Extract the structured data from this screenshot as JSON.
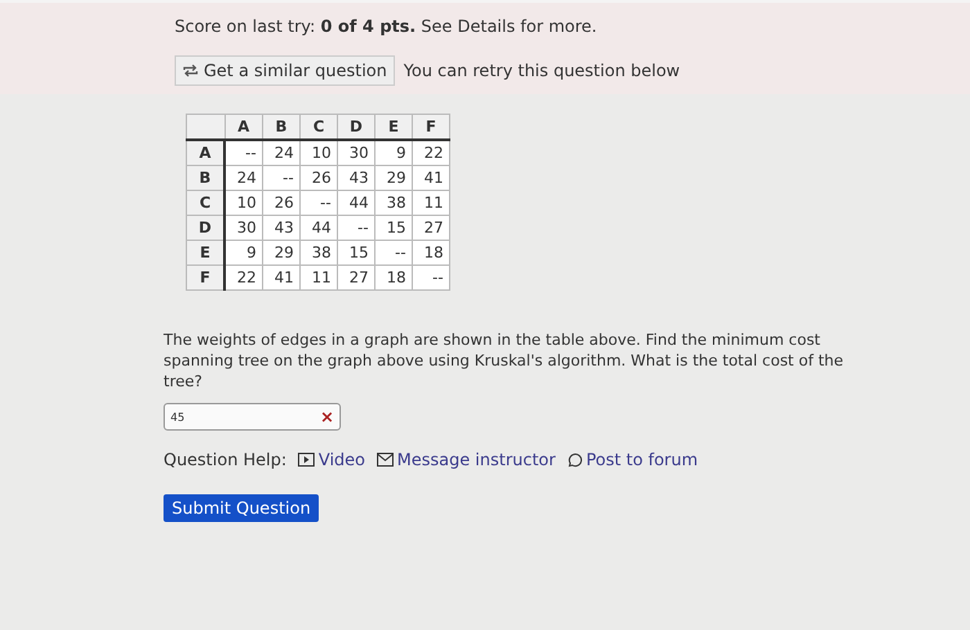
{
  "score_line": "Score on last try: **0 of 4 pts.** See Details for more.",
  "similar_button": {
    "label": "Get a similar question"
  },
  "retry_note": "You can retry this question below",
  "table": {
    "columns": [
      "A",
      "B",
      "C",
      "D",
      "E",
      "F"
    ],
    "rows": [
      {
        "label": "A",
        "cells": [
          "--",
          "24",
          "10",
          "30",
          "9",
          "22"
        ]
      },
      {
        "label": "B",
        "cells": [
          "24",
          "--",
          "26",
          "43",
          "29",
          "41"
        ]
      },
      {
        "label": "C",
        "cells": [
          "10",
          "26",
          "--",
          "44",
          "38",
          "11"
        ]
      },
      {
        "label": "D",
        "cells": [
          "30",
          "43",
          "44",
          "--",
          "15",
          "27"
        ]
      },
      {
        "label": "E",
        "cells": [
          "9",
          "29",
          "38",
          "15",
          "--",
          "18"
        ]
      },
      {
        "label": "F",
        "cells": [
          "22",
          "41",
          "11",
          "27",
          "18",
          "--"
        ]
      }
    ]
  },
  "question": "The weights of edges in a graph are shown in the table above. Find the minimum cost spanning tree on the graph above using Kruskal's algorithm. What is the total cost of the tree?",
  "answer": {
    "value": "45",
    "mark": "×"
  },
  "help": {
    "label": "Question Help:",
    "links": [
      {
        "kind": "video",
        "label": "Video"
      },
      {
        "kind": "message",
        "label": "Message instructor"
      },
      {
        "kind": "forum",
        "label": "Post to forum"
      }
    ]
  },
  "submit_button": "Submit Question"
}
